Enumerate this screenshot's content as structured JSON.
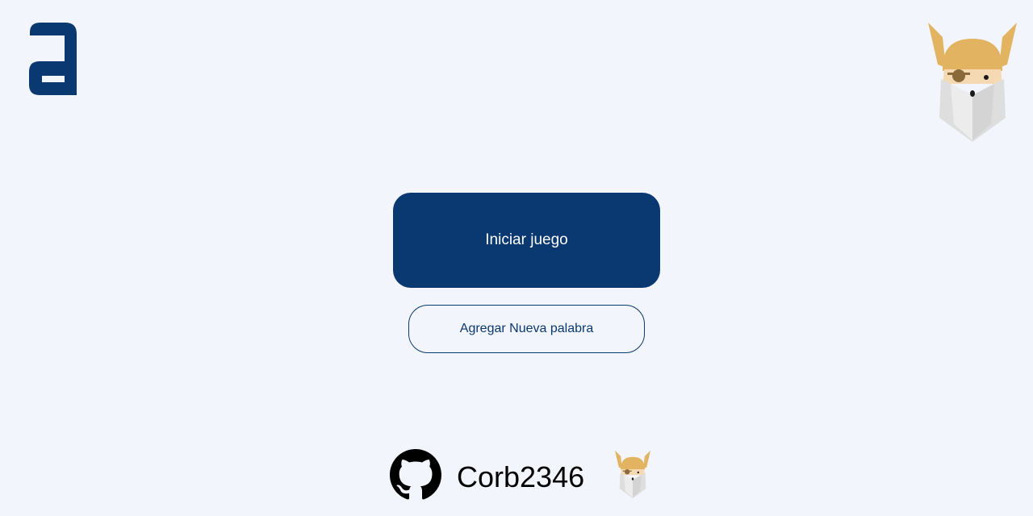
{
  "header": {
    "logo_icon": "alura-a-logo",
    "mascot_icon": "viking-mascot-icon"
  },
  "actions": {
    "start_label": "Iniciar juego",
    "add_word_label": "Agregar Nueva palabra"
  },
  "footer": {
    "github_icon": "github-icon",
    "username": "Corb2346",
    "mascot_icon": "viking-mascot-icon"
  },
  "colors": {
    "background": "#f3f5fc",
    "primary": "#0a3871",
    "helmet": "#e2b462",
    "beard": "#dedede"
  }
}
